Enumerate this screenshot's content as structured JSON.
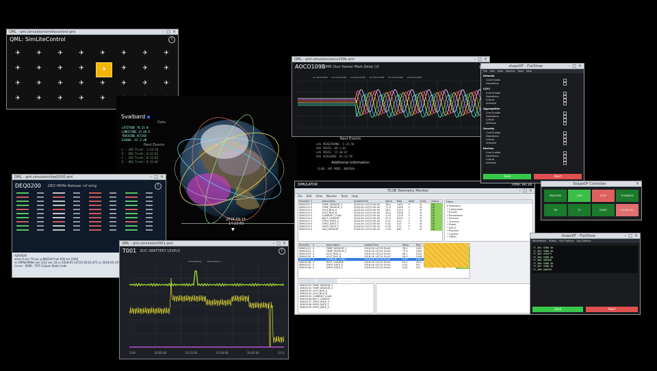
{
  "simlite": {
    "title_bar": "QML - qml.simulator/simlitecontrol.qml",
    "window_title": "QML: SimLiteControl",
    "pad_icon": "satellite-icon",
    "highlight_index": 12,
    "accent": "#f5b400"
  },
  "map": {
    "station": "Svalbard",
    "station_color": "#2b62ff",
    "data_label": "Data",
    "info_lines": [
      "LATITUDE  78.23 N",
      "LONGITUDE  15.48 E",
      "TRACKING   ACTIVE",
      "SIGNAL    -67.2 dB"
    ],
    "next_events_label": "Next Events",
    "events": [
      "L - LOS T+sat: 1:23:58",
      "S - AOS T+sat: 0:12:03",
      "L - LOS T+sat: 0:12:03",
      "S - AOS T+sat: 0:12:03"
    ],
    "date": "2018-09-15",
    "time": "14:22:50"
  },
  "aoco": {
    "title_bar": "QML - qml.simulator/aoco109b.qml",
    "window_title": "AOCO109B",
    "subtitle": "DMR (Sun Sensor Main Data) (2)",
    "legend": [
      "A1 AOCO109B",
      "A2 AOCO109B",
      "A3 AOCO109B",
      "A4 AOCO109B",
      "A5 AOCO109B",
      "A6 AOCO109B"
    ],
    "series_colors": [
      "#f5f5f5",
      "#ff5cff",
      "#ff6b2b",
      "#ffe340",
      "#3aa8ff",
      "#4cf08a"
    ]
  },
  "next_events": {
    "title": "Next Events",
    "lines": [
      "LOS PERSEPHONE: 1:23:58",
      "AOS FRAIS: 09:3.02",
      "LOS FRAIS: 15:30:07",
      "AOS SVALBARD: 01:22:58"
    ],
    "additional_label": "Additional Information",
    "additional_value": "SLAN: AOS MODE: NOMINAL"
  },
  "deq": {
    "title_bar": "QML - qml.simulator/deq0200.qml",
    "window_title": "DEQ0200",
    "subtitle": "DEQ HRMe Release +X wing",
    "status_line1": "ADVISOR",
    "status_line2": "arms 0 sec 74 sec p-8602/hf hull 000 ms 5500",
    "status_line3": "sc HRMe/RMIel sec 2/12 sec 18 sc 2018-05-14T23:30:01.875 sc 2018-05-14T23:29:50.800 sec",
    "status_line4": "Curve",
    "status_line5": "0006 - TOT Eclipse State Code"
  },
  "t001": {
    "title_bar": "QML - qml.simulator/t001.qml",
    "window_title": "T001",
    "subtitle": "EOC XBATTERY LEVELS",
    "legend": [
      "T001 Battery",
      "T002 Battery"
    ],
    "x_ticks": [
      "09:45:00",
      "10:00:00",
      "10:15:00",
      "10:30:00",
      "10:45:00",
      "11:00:00"
    ],
    "series_colors": [
      "#9acd32",
      "#e8e037",
      "#b44dd8"
    ]
  },
  "telem": {
    "title_bar": "TCDB Telemetry Monitor",
    "app_label": "SIMULATOR",
    "time_label": "Time: 60:18",
    "menus": [
      "File",
      "Edit",
      "View",
      "Monitor",
      "Tools",
      "Help"
    ],
    "columns": [
      "ParamID",
      "C",
      "Description",
      "UpdateTime",
      "Value",
      "Raw",
      "Valid",
      "Limit",
      "Status"
    ],
    "rows": [
      [
        "SIM00131",
        "S",
        "TEMP_SENSOR_1",
        "2018-09-14T23:30:00",
        "78.2",
        "1452",
        "Y",
        "N",
        "OK"
      ],
      [
        "SIM00132",
        "S",
        "TEMP_SENSOR_2",
        "2018-09-14T23:30:00",
        "77.9",
        "1449",
        "Y",
        "N",
        "OK"
      ],
      [
        "SIM00133",
        "S",
        "VOLT_BUS_A",
        "2018-09-14T23:30:00",
        "28.1",
        "2210",
        "Y",
        "N",
        "OK"
      ],
      [
        "SIM00134",
        "S",
        "VOLT_BUS_B",
        "2018-09-14T23:30:00",
        "28.0",
        "2208",
        "Y",
        "N",
        "OK"
      ],
      [
        "SIM00135",
        "S",
        "CURRENT_LOAD",
        "2018-09-14T23:30:00",
        "4.25",
        "1104",
        "Y",
        "N",
        "OK"
      ],
      [
        "SIM00136",
        "S",
        "BATT_CHARGE",
        "2018-09-14T23:30:00",
        "92.5",
        "3011",
        "Y",
        "N",
        "OK"
      ],
      [
        "SIM00137",
        "S",
        "GYRO_RATE_X",
        "2018-09-14T23:30:00",
        "0.01",
        "512",
        "Y",
        "N",
        "OK"
      ],
      [
        "SIM00138",
        "S",
        "GYRO_RATE_Y",
        "2018-09-14T23:30:00",
        "0.02",
        "513",
        "Y",
        "N",
        "OK"
      ],
      [
        "SIM00139",
        "S",
        "GYRO_RATE_Z",
        "2018-09-14T23:30:00",
        "0.00",
        "511",
        "Y",
        "N",
        "OK"
      ],
      [
        "SIM00140",
        "S",
        "SUN_SENSOR",
        "2018-09-14T23:30:00",
        "1.05",
        "640",
        "Y",
        "N",
        "OK"
      ]
    ],
    "tree_title": "Filters",
    "tree_items": [
      "Telemetry",
      "Commands",
      "Events",
      "Parameters",
      "Sensors",
      "Thermal",
      "Power",
      "AOCS",
      "Payload",
      "Comms",
      "OBDH"
    ],
    "tab_labels": [
      "Properties",
      "Parameters",
      "Notifications"
    ]
  },
  "smdf": {
    "title_bar": "shapeDF - FlatShow",
    "menus": [
      "File",
      "Edit",
      "View",
      "Monitor",
      "Tools",
      "Help"
    ],
    "section_labels": [
      "Defaults",
      "CCP1",
      "Aggregation",
      "Security",
      "Devices"
    ],
    "rows": [
      "Cmd Enable",
      "Hazardous",
      "Critical",
      "Interlock",
      "Verify",
      "Timeout"
    ],
    "btn_green": "Send",
    "btn_red": "Abort",
    "green": "#37c84a",
    "red": "#e05050"
  },
  "ctrl": {
    "title_bar": "ShapeDF Controller",
    "buttons": [
      "REALTIME",
      "CMD",
      "STOP",
      "PLAYBACK",
      "TM",
      "TC",
      "DUMP",
      "CLOSE ALL"
    ],
    "btn_colors": [
      "#1b7a2c",
      "#3dbe48",
      "#e06060",
      "#1b7a2c",
      "#1b7a2c",
      "#1b7a2c",
      "#1b7a2c",
      "#e07070"
    ]
  },
  "flat": {
    "title_bar": "shapeDF - FlatShow",
    "menus": [
      "Parameters",
      "Status",
      "Run Options",
      "Log Options"
    ],
    "lines": [
      "TC_001 SEND OK",
      "TC_002 SEND OK",
      "TC_003 VERIFY",
      "TC_004 SEND OK",
      "TC_005 QUEUED",
      "TC_006 SEND OK",
      "TC_007 SEND OK",
      "TC_008 QUEUED"
    ],
    "footer_left": "Send",
    "footer_right": "Abort"
  }
}
